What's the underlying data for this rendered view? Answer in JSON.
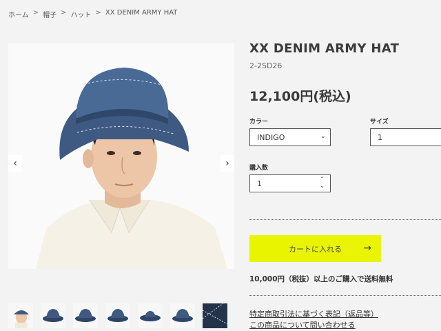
{
  "breadcrumb": {
    "items": [
      "ホーム",
      "帽子",
      "ハット",
      "XX DENIM ARMY HAT"
    ],
    "separator": ">"
  },
  "gallery": {
    "prev_icon": "chevron-left-icon",
    "next_icon": "chevron-right-icon",
    "thumbnail_count": 7
  },
  "product": {
    "title": "XX DENIM ARMY HAT",
    "code": "2-2SD26",
    "price": "12,100円(税込)"
  },
  "options": {
    "color_label": "カラー",
    "color_value": "INDIGO",
    "size_label": "サイズ",
    "size_value": "1",
    "quantity_label": "購入数",
    "quantity_value": "1"
  },
  "cart": {
    "button_label": "カートに入れる",
    "arrow": "→",
    "accent_color": "#e9f500"
  },
  "shipping_note": "10,000円（税抜）以上のご購入で送料無料",
  "links": {
    "legal": "特定商取引法に基づく表記（返品等）",
    "inquiry": "この商品について問い合わせる"
  }
}
